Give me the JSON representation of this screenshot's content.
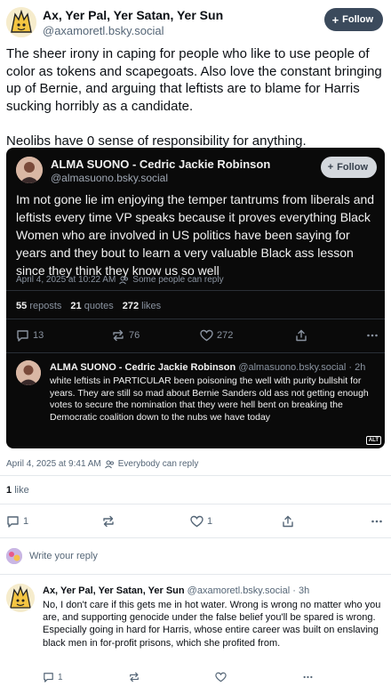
{
  "post": {
    "author_name": "Ax, Yer Pal, Yer Satan, Yer Sun",
    "author_handle": "@axamoretl.bsky.social",
    "follow_label": "Follow",
    "paragraphs": [
      "The sheer irony in caping for people who like to use people of color as tokens and scapegoats. Also love the constant bringing up of Bernie, and arguing that leftists are to blame for Harris sucking horribly as a candidate.",
      "Neolibs have 0 sense of responsibility for anything."
    ],
    "timestamp": "April 4, 2025 at 9:41 AM",
    "reply_setting": "Everybody can reply",
    "likes_count": "1",
    "likes_label": "like",
    "actions": {
      "replies": "1",
      "reposts": "",
      "likes": "1"
    }
  },
  "quote": {
    "author_name": "ALMA SUONO - Cedric Jackie Robinson",
    "author_handle": "@almasuono.bsky.social",
    "follow_label": "Follow",
    "text": "Im not gone lie im enjoying the temper tantrums from liberals and leftists every time VP speaks because it proves everything Black Women who are involved in US politics have been saying for years and they bout to learn a very valuable Black ass lesson since they think they know us so well",
    "timestamp": "April 4, 2025 at 10:22 AM",
    "reply_setting": "Some people can reply",
    "stats": {
      "reposts_count": "55",
      "reposts_label": "reposts",
      "quotes_count": "21",
      "quotes_label": "quotes",
      "likes_count": "272",
      "likes_label": "likes"
    },
    "actions": {
      "replies": "13",
      "reposts": "76",
      "likes": "272"
    },
    "reply": {
      "author_name": "ALMA SUONO - Cedric Jackie Robinson",
      "author_handle": "@almasuono.bsky.social",
      "age": "· 2h",
      "text": "white leftists in PARTICULAR been poisoning the well with purity bullshit for years. They are still so mad about Bernie Sanders old ass not getting enough votes to secure the nomination that they were hell bent on breaking the Democratic coalition down to the nubs we have today",
      "alt_badge": "ALT"
    }
  },
  "reply_prompt": "Write your reply",
  "comment": {
    "author_name": "Ax, Yer Pal, Yer Satan, Yer Sun",
    "author_handle": "@axamoretl.bsky.social",
    "age": "· 3h",
    "text": "No, I don't care if this gets me in hot water. Wrong is wrong no matter who you are, and supporting genocide under the false belief you'll be spared is wrong. Especially going in hard for Harris, whose entire career was built on enslaving black men in for-profit prisons, which she profited from.",
    "actions": {
      "replies": "1",
      "reposts": "",
      "likes": ""
    }
  },
  "colors": {
    "brand_blue": "#1083fe",
    "text_muted": "#556677",
    "quote_bg": "#0a0a0a"
  }
}
